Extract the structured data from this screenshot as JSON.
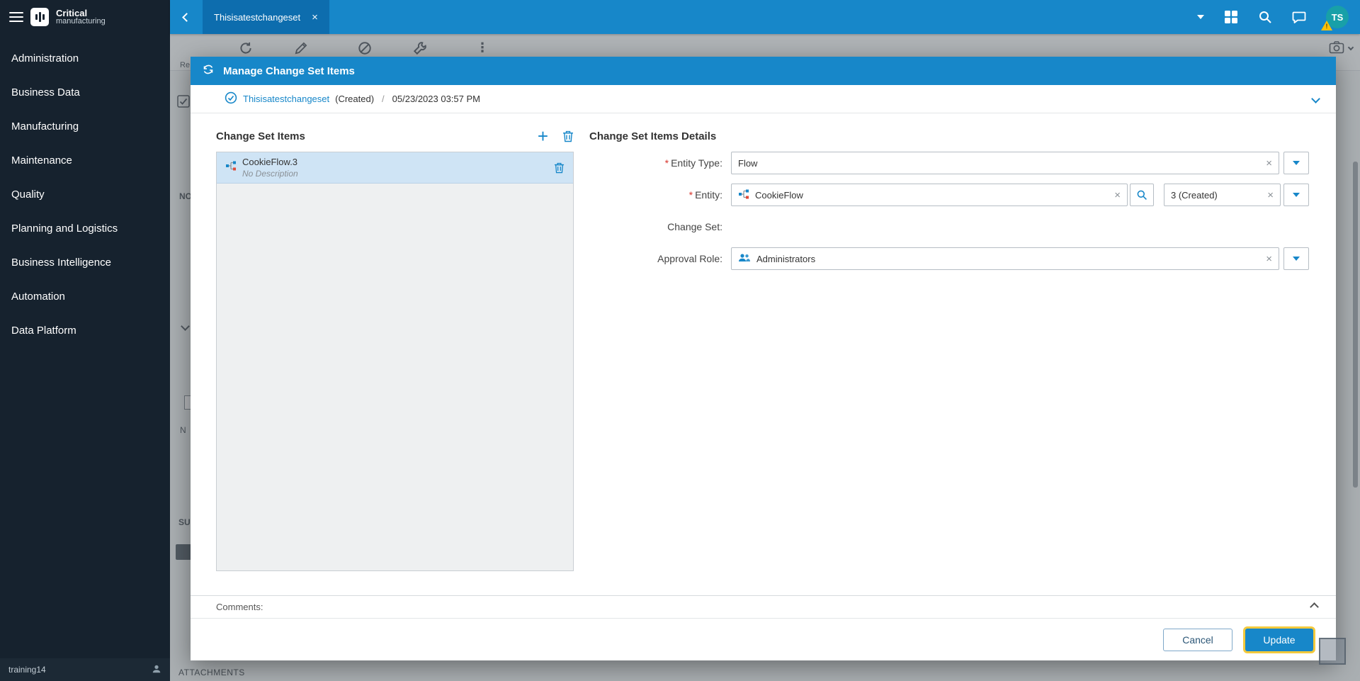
{
  "app": {
    "brand_bold": "Critical",
    "brand_light": "manufacturing"
  },
  "topbar": {
    "tab_title": "Thisisatestchangeset",
    "close_glyph": "×",
    "avatar_initials": "TS",
    "warning_glyph": "!"
  },
  "sidebar": {
    "items": [
      {
        "label": "Administration"
      },
      {
        "label": "Business Data"
      },
      {
        "label": "Manufacturing"
      },
      {
        "label": "Maintenance"
      },
      {
        "label": "Quality"
      },
      {
        "label": "Planning and Logistics"
      },
      {
        "label": "Business Intelligence"
      },
      {
        "label": "Automation"
      },
      {
        "label": "Data Platform"
      }
    ],
    "footer_user": "training14"
  },
  "background": {
    "toolbar_hint": "Re",
    "dots_glyph": "⋮",
    "fragment_no": "NO",
    "fragment_n": "N",
    "fragment_su": "SU",
    "attachments_label": "ATTACHMENTS"
  },
  "modal": {
    "title": "Manage Change Set Items",
    "breadcrumb": {
      "name": "Thisisatestchangeset",
      "state": "(Created)",
      "separator": "/",
      "timestamp": "05/23/2023 03:57 PM"
    },
    "items_panel": {
      "heading": "Change Set Items",
      "items": [
        {
          "title": "CookieFlow.3",
          "description": "No Description"
        }
      ]
    },
    "details_panel": {
      "heading": "Change Set Items Details",
      "required_marker": "*",
      "fields": {
        "entity_type": {
          "label": "Entity Type:",
          "value": "Flow"
        },
        "entity": {
          "label": "Entity:",
          "value": "CookieFlow",
          "version": "3 (Created)"
        },
        "change_set": {
          "label": "Change Set:",
          "value": ""
        },
        "approval_role": {
          "label": "Approval Role:",
          "value": "Administrators"
        }
      }
    },
    "comments": {
      "label": "Comments:"
    },
    "footer": {
      "cancel_label": "Cancel",
      "update_label": "Update"
    }
  },
  "icons": {
    "plus": "+",
    "clear": "×"
  },
  "colors": {
    "accent_blue": "#1787c9",
    "tab_blue": "#0d6dae",
    "sidebar_bg": "#16222e",
    "selected_item_bg": "#cfe4f5",
    "focus_ring_yellow": "#f3c93c",
    "required_red": "#d8342c",
    "avatar_teal": "#18a0a8",
    "warning_yellow": "#ffc107"
  }
}
